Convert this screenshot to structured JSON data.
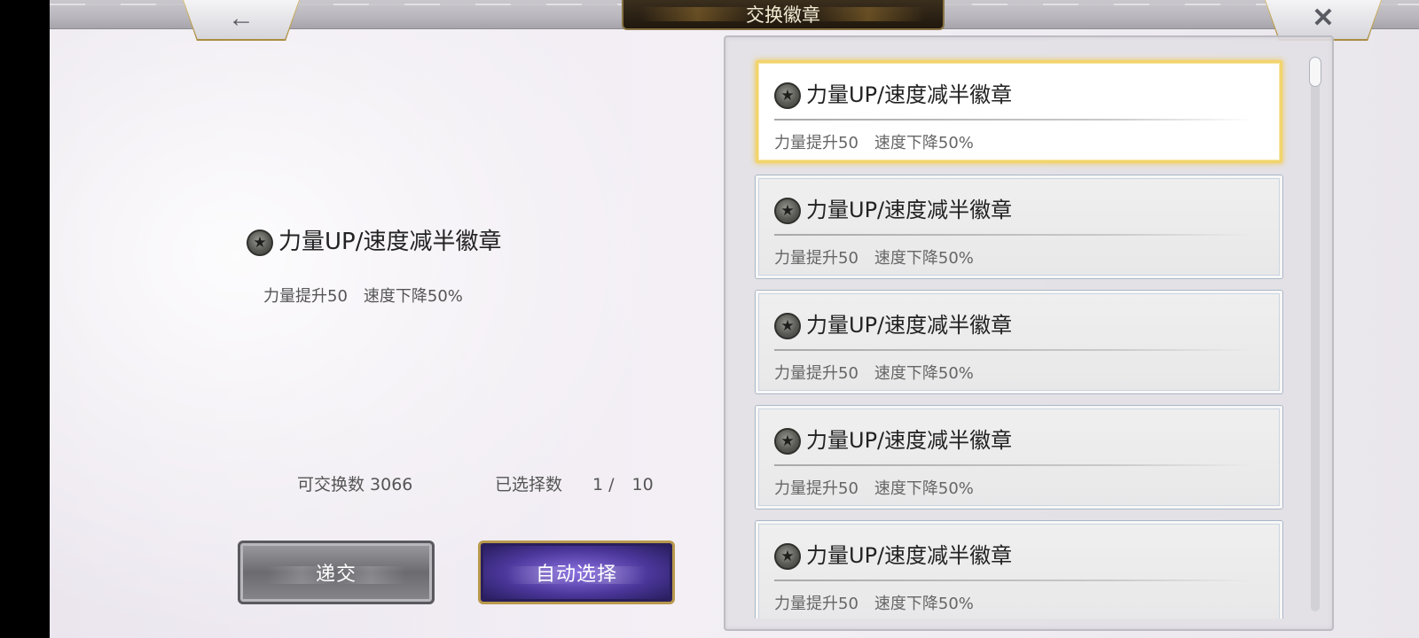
{
  "header": {
    "title": "交换徽章",
    "back_icon": "←",
    "close_icon": "✕"
  },
  "detail": {
    "badge_name": "力量UP/速度减半徽章",
    "badge_desc": "力量提升50　速度下降50%"
  },
  "stats": {
    "exchangeable_label": "可交换数 3066",
    "selected_label": "已选择数",
    "selected_count": "1 /",
    "selected_max": "10"
  },
  "buttons": {
    "submit_label": "递交",
    "auto_select_label": "自动选择"
  },
  "badge_list": [
    {
      "name": "力量UP/速度减半徽章",
      "desc": "力量提升50　速度下降50%",
      "selected": true
    },
    {
      "name": "力量UP/速度减半徽章",
      "desc": "力量提升50　速度下降50%",
      "selected": false
    },
    {
      "name": "力量UP/速度减半徽章",
      "desc": "力量提升50　速度下降50%",
      "selected": false
    },
    {
      "name": "力量UP/速度减半徽章",
      "desc": "力量提升50　速度下降50%",
      "selected": false
    },
    {
      "name": "力量UP/速度减半徽章",
      "desc": "力量提升50　速度下降50%",
      "selected": false
    }
  ],
  "colors": {
    "selected_border": "#f2d46c",
    "auto_button": "#4a3699",
    "submit_button": "#6b6b70"
  }
}
